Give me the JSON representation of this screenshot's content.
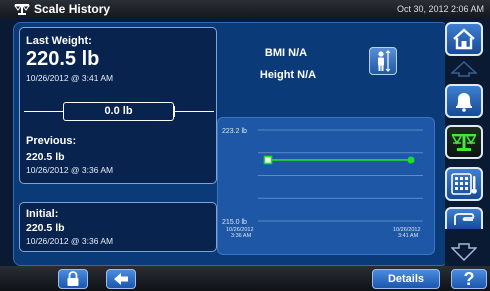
{
  "header": {
    "title": "Scale History",
    "datetime": "Oct 30, 2012 2:06 AM"
  },
  "last": {
    "label": "Last Weight:",
    "value": "220.5 lb",
    "timestamp": "10/26/2012 @ 3:41 AM"
  },
  "bmi": "BMI N/A",
  "height": "Height N/A",
  "difference": "0.0 lb",
  "previous": {
    "label": "Previous:",
    "value": "220.5 lb",
    "timestamp": "10/26/2012 @ 3:36 AM"
  },
  "initial": {
    "label": "Initial:",
    "value": "220.5 lb",
    "timestamp": "10/26/2012 @ 3:36 AM"
  },
  "chart_data": {
    "type": "line",
    "y_tick_labels": [
      "223.2 lb",
      "215.0 lb"
    ],
    "ylim": [
      215.0,
      223.2
    ],
    "x_tick_labels": [
      {
        "date": "10/26/2012",
        "time": "3:36 AM"
      },
      {
        "date": "10/26/2012",
        "time": "3:41 AM"
      }
    ],
    "points": [
      {
        "x": "10/26/2012 3:36 AM",
        "y": 220.5
      },
      {
        "x": "10/26/2012 3:41 AM",
        "y": 220.5
      }
    ],
    "line_color": "#1fe01f",
    "grid": true
  },
  "footer": {
    "details_label": "Details",
    "help_label": "?"
  },
  "colors": {
    "panel": "#0b3a78",
    "card": "#08234d",
    "accent": "#2c6fd0"
  }
}
